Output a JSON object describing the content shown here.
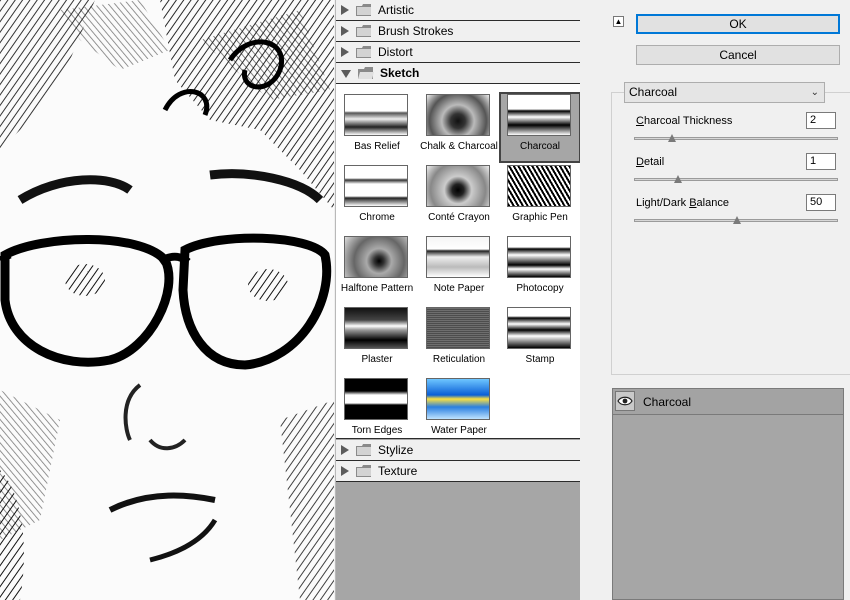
{
  "gallery": {
    "categories_top": [
      {
        "label": "Artistic",
        "expanded": false
      },
      {
        "label": "Brush Strokes",
        "expanded": false
      },
      {
        "label": "Distort",
        "expanded": false
      },
      {
        "label": "Sketch",
        "expanded": true
      }
    ],
    "sketch_filters": [
      {
        "label": "Bas Relief"
      },
      {
        "label": "Chalk & Charcoal"
      },
      {
        "label": "Charcoal",
        "selected": true
      },
      {
        "label": "Chrome"
      },
      {
        "label": "Conté Crayon"
      },
      {
        "label": "Graphic Pen"
      },
      {
        "label": "Halftone Pattern"
      },
      {
        "label": "Note Paper"
      },
      {
        "label": "Photocopy"
      },
      {
        "label": "Plaster"
      },
      {
        "label": "Reticulation"
      },
      {
        "label": "Stamp"
      },
      {
        "label": "Torn Edges"
      },
      {
        "label": "Water Paper"
      }
    ],
    "categories_bottom": [
      {
        "label": "Stylize"
      },
      {
        "label": "Texture"
      }
    ]
  },
  "dialog": {
    "ok_label": "OK",
    "cancel_label": "Cancel",
    "collapse_glyph": "▲"
  },
  "filter_select": {
    "value": "Charcoal"
  },
  "params": [
    {
      "label_u": "C",
      "label_rest": "harcoal Thickness",
      "value": "2",
      "min": 1,
      "max": 7,
      "level": 2
    },
    {
      "label_u": "D",
      "label_rest": "etail",
      "value": "1",
      "min": 0,
      "max": 5,
      "level": 1
    },
    {
      "label_pre": "Light/Dark ",
      "label_u": "B",
      "label_rest": "alance",
      "value": "50",
      "min": 0,
      "max": 100,
      "level": 50
    }
  ],
  "layers": [
    {
      "name": "Charcoal",
      "visible": true
    }
  ],
  "colors": {
    "gallery_bg": "#a6a6a6",
    "panel_bg": "#f0f0f0",
    "ok_border": "#0078d7"
  }
}
